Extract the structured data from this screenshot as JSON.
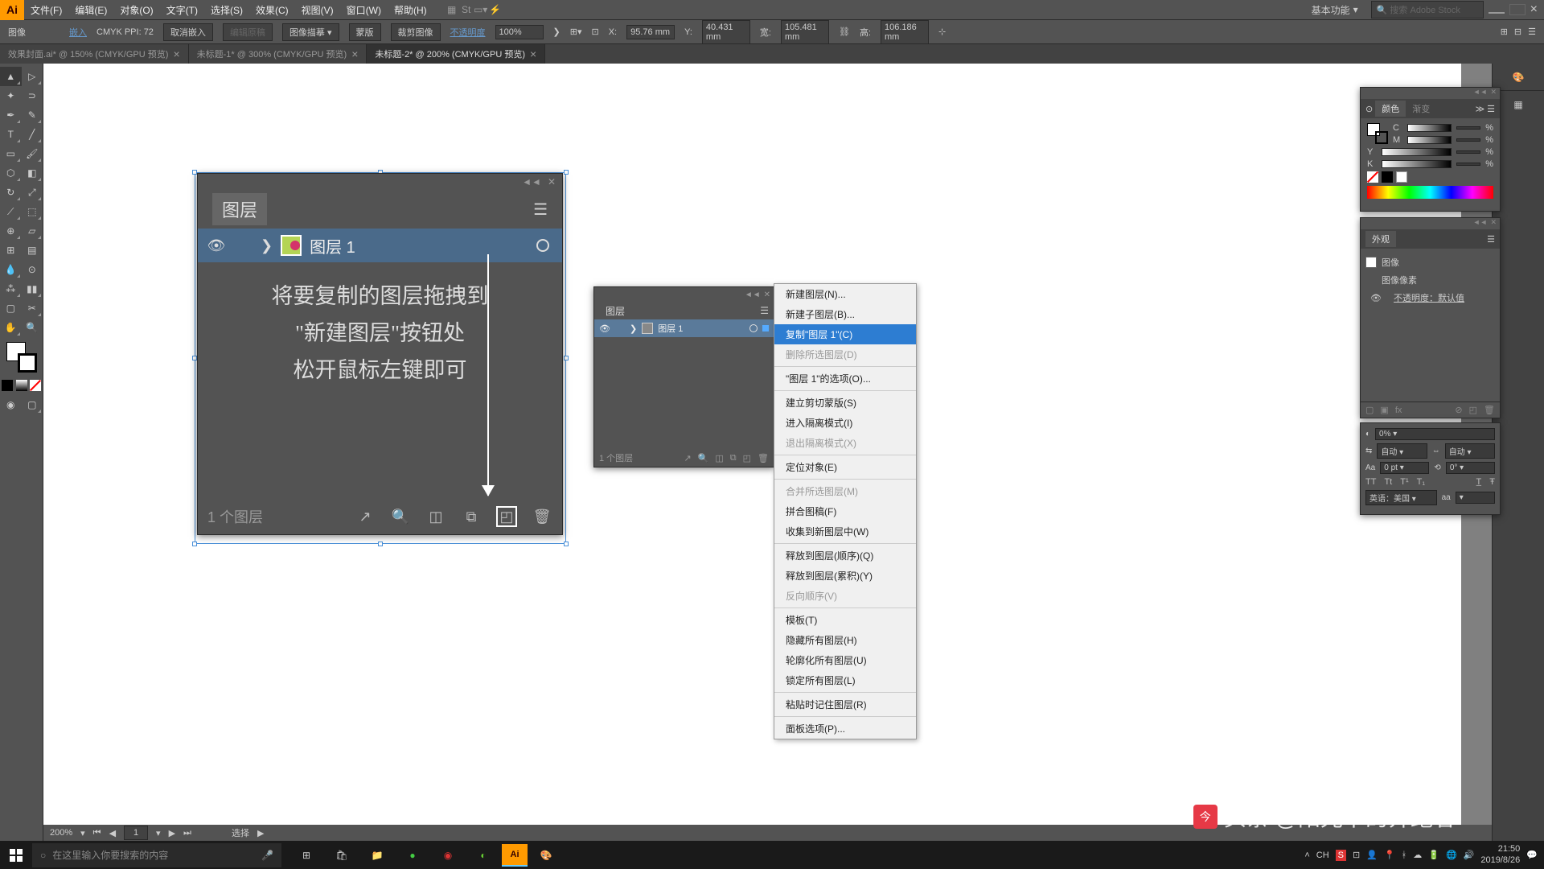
{
  "menubar": {
    "logo": "Ai",
    "items": [
      "文件(F)",
      "编辑(E)",
      "对象(O)",
      "文字(T)",
      "选择(S)",
      "效果(C)",
      "视图(V)",
      "窗口(W)",
      "帮助(H)"
    ],
    "workspace": "基本功能",
    "search_placeholder": "搜索 Adobe Stock"
  },
  "controlbar": {
    "type": "图像",
    "embed": "嵌入",
    "ppi_label": "CMYK PPI:",
    "ppi": "72",
    "unembed": "取消嵌入",
    "edit_original": "编辑原稿",
    "image_trace": "图像描摹",
    "mask": "蒙版",
    "crop": "裁剪图像",
    "opacity_label": "不透明度",
    "opacity": "100%",
    "x_label": "X:",
    "x_val": "95.76 mm",
    "y_label": "Y:",
    "y_val": "40.431 mm",
    "w_label": "宽:",
    "w_val": "105.481 mm",
    "h_label": "高:",
    "h_val": "106.186 mm"
  },
  "doc_tabs": [
    {
      "label": "效果封面.ai* @ 150% (CMYK/GPU 预览)",
      "active": false
    },
    {
      "label": "未标题-1* @ 300% (CMYK/GPU 预览)",
      "active": false
    },
    {
      "label": "未标题-2* @ 200% (CMYK/GPU 预览)",
      "active": true
    }
  ],
  "big_layers": {
    "title": "图层",
    "layer_name": "图层 1",
    "instruction": "将要复制的图层拖拽到\n\"新建图层\"按钮处\n松开鼠标左键即可",
    "count": "1 个图层"
  },
  "small_layers": {
    "title": "图层",
    "layer_name": "图层 1",
    "count": "1 个图层"
  },
  "context_menu": {
    "items": [
      {
        "label": "新建图层(N)...",
        "enabled": true
      },
      {
        "label": "新建子图层(B)...",
        "enabled": true
      },
      {
        "label": "复制\"图层 1\"(C)",
        "enabled": true,
        "highlighted": true
      },
      {
        "label": "删除所选图层(D)",
        "enabled": false
      },
      {
        "sep": true
      },
      {
        "label": "\"图层 1\"的选项(O)...",
        "enabled": true
      },
      {
        "sep": true
      },
      {
        "label": "建立剪切蒙版(S)",
        "enabled": true
      },
      {
        "label": "进入隔离模式(I)",
        "enabled": true
      },
      {
        "label": "退出隔离模式(X)",
        "enabled": false
      },
      {
        "sep": true
      },
      {
        "label": "定位对象(E)",
        "enabled": true
      },
      {
        "sep": true
      },
      {
        "label": "合并所选图层(M)",
        "enabled": false
      },
      {
        "label": "拼合图稿(F)",
        "enabled": true
      },
      {
        "label": "收集到新图层中(W)",
        "enabled": true
      },
      {
        "sep": true
      },
      {
        "label": "释放到图层(顺序)(Q)",
        "enabled": true
      },
      {
        "label": "释放到图层(累积)(Y)",
        "enabled": true
      },
      {
        "label": "反向顺序(V)",
        "enabled": false
      },
      {
        "sep": true
      },
      {
        "label": "模板(T)",
        "enabled": true
      },
      {
        "label": "隐藏所有图层(H)",
        "enabled": true
      },
      {
        "label": "轮廓化所有图层(U)",
        "enabled": true
      },
      {
        "label": "锁定所有图层(L)",
        "enabled": true
      },
      {
        "sep": true
      },
      {
        "label": "粘贴时记住图层(R)",
        "enabled": true
      },
      {
        "sep": true
      },
      {
        "label": "面板选项(P)...",
        "enabled": true
      }
    ]
  },
  "color_panel": {
    "title": "颜色",
    "tab2": "渐变",
    "channels": [
      "C",
      "M",
      "Y",
      "K"
    ]
  },
  "appearance_panel": {
    "title": "外观",
    "rows": [
      "图像",
      "图像像素",
      "不透明度：默认值"
    ]
  },
  "char_panel": {
    "opacity": "0%",
    "auto": "自动",
    "auto2": "自动",
    "pt": "0 pt",
    "deg": "0°",
    "lang": "英语：美国"
  },
  "statusbar": {
    "zoom": "200%",
    "page": "1",
    "tool": "选择"
  },
  "taskbar": {
    "search_placeholder": "在这里输入你要搜索的内容",
    "ime": "CH",
    "time": "21:50",
    "date": "2019/8/26"
  },
  "watermark": "头条 @阳光下的奔跑者"
}
